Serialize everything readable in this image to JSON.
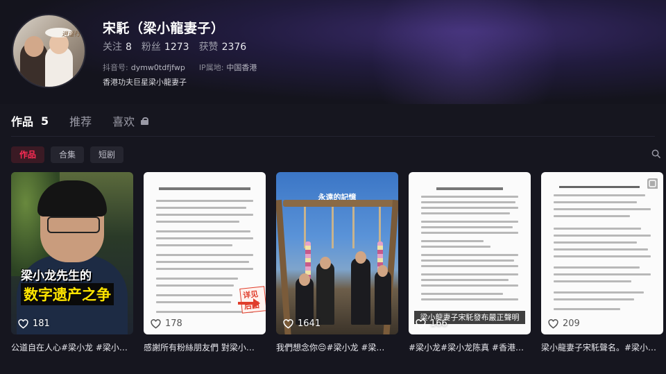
{
  "profile": {
    "name": "宋馲（梁小龍妻子）",
    "avatar_text": "逍遥行",
    "stats": [
      {
        "label": "关注",
        "value": "8"
      },
      {
        "label": "粉丝",
        "value": "1273"
      },
      {
        "label": "获赞",
        "value": "2376"
      }
    ],
    "douyin_id_label": "抖音号:",
    "douyin_id": "dymw0tdfjfwp",
    "ip_label": "IP属地:",
    "ip_value": "中国香港",
    "bio": "香港功夫巨星梁小龍妻子"
  },
  "tabs": [
    {
      "label": "作品",
      "count": "5"
    },
    {
      "label": "推荐"
    },
    {
      "label": "喜欢"
    }
  ],
  "filters": [
    "作品",
    "合集",
    "短剧"
  ],
  "videos": [
    {
      "likes": "181",
      "caption": "公道自在人心#梁小龙 #梁小…",
      "overlay_line1": "梁小龙先生的",
      "overlay_line2": "数字遗产之争"
    },
    {
      "likes": "178",
      "caption": "感謝所有粉絲朋友們 對梁小…",
      "stamp": "详见后图"
    },
    {
      "likes": "1641",
      "caption": "我們想念你😔#梁小龙 #梁…",
      "overlay_title": "永遠的記憶"
    },
    {
      "likes": "166",
      "caption": "#梁小龙#梁小龙陈真 #香港…",
      "banner": "梁小龍妻子宋馲發布嚴正聲明"
    },
    {
      "likes": "209",
      "caption": "梁小龍妻子宋馲聲名。#梁小…"
    }
  ],
  "colors": {
    "accent": "#fe2c55",
    "background": "#16161f"
  },
  "icons": {
    "search": "search-icon",
    "lock": "lock-icon",
    "heart": "heart-icon",
    "copy": "copy-icon"
  }
}
